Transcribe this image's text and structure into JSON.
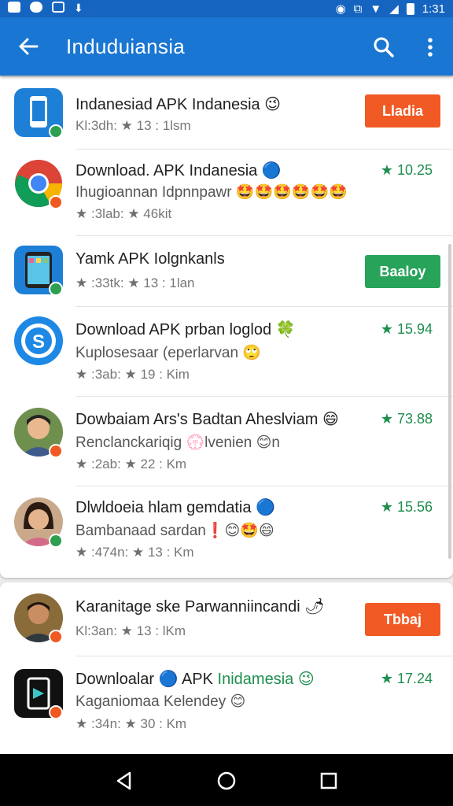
{
  "status_bar": {
    "time": "1:31",
    "icons": [
      "notification-icon",
      "cloud-icon",
      "link-icon",
      "download-icon",
      "alarm-icon",
      "vibrate-icon",
      "wifi-icon",
      "signal-icon",
      "battery-icon"
    ]
  },
  "app_bar": {
    "title": "Induduiansia",
    "back_icon": "arrow-back-icon",
    "search_icon": "search-icon",
    "more_icon": "more-vert-icon",
    "color": "#1976d2"
  },
  "list_card_1": [
    {
      "icon": "phone-app-icon",
      "title": "Indanesiad APK Indanesia 😉",
      "meta_left": "Kl:3dh:",
      "meta_right": "13 : 1lsm",
      "action": {
        "type": "button",
        "label": "Lladia",
        "color": "#f15a24"
      }
    },
    {
      "icon": "chrome-app-icon",
      "title": "Download. APK Indanesia 🔵",
      "subtitle": "Ihugioannan Idpnnpawr 🤩🤩🤩🤩🤩🤩",
      "meta_left": ":3lab:",
      "meta_right": "46kit",
      "action": {
        "type": "rating",
        "label": "10.25"
      }
    },
    {
      "icon": "tablet-app-icon",
      "title": "Yamk APK Iolgnkanls",
      "meta_left": ":33tk:",
      "meta_right": "13 : 1lan",
      "action": {
        "type": "button",
        "label": "Baaloy",
        "color": "#27a35a"
      }
    },
    {
      "icon": "skype-app-icon",
      "title": "Download APK prban loglod 🍀",
      "subtitle": "Kuplosesaar (eperlarvan 🙄",
      "meta_left": ":3ab:",
      "meta_right": "19 : Kim",
      "action": {
        "type": "rating",
        "label": "15.94"
      }
    },
    {
      "icon": "avatar-man-icon",
      "title": "Dowbaiam Ars's Badtan Aheslviam 😄",
      "subtitle": "Renclanckariqig 💮lvenien 😊n",
      "meta_left": ":2ab:",
      "meta_right": "22 : Km",
      "action": {
        "type": "rating",
        "label": "73.88"
      }
    },
    {
      "icon": "avatar-woman-icon",
      "title": "Dlwldoeia hlam gemdatia 🔵",
      "subtitle": "Bambanaad sardan❗😊🤩😄",
      "meta_left": ":474n:",
      "meta_right": "13 : Km",
      "action": {
        "type": "rating",
        "label": "15.56"
      }
    }
  ],
  "list_card_2": [
    {
      "icon": "avatar-man2-icon",
      "title": "Karanitage ske Parwanniincandi 🌶",
      "meta_left": "Kl:3an:",
      "meta_right": "13 : lKm",
      "action": {
        "type": "button",
        "label": "Tbbaj",
        "color": "#f15a24"
      }
    },
    {
      "icon": "dark-app-icon",
      "title_prefix": "Downloalar 🔵 APK ",
      "title_suffix": "Inidamesia 😉",
      "subtitle": "Kaganiomaa Kelendey 😊",
      "meta_left": ":34n:",
      "meta_right": "30 : Km",
      "action": {
        "type": "rating",
        "label": "17.24"
      }
    }
  ],
  "nav_bar": {
    "back": "nav-back-icon",
    "home": "nav-home-icon",
    "recents": "nav-recents-icon"
  }
}
